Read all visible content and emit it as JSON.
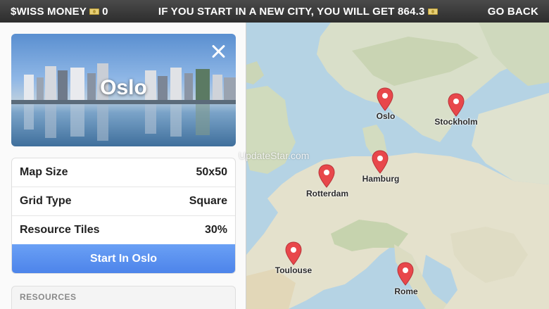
{
  "topbar": {
    "money_label": "$WISS MONEY",
    "money_icon": "cash-icon",
    "money_value": "0",
    "message": "IF YOU START IN A NEW CITY, YOU WILL GET 864.3",
    "go_back": "GO BACK"
  },
  "selected_city": {
    "name": "Oslo",
    "details": [
      {
        "label": "Map Size",
        "value": "50x50"
      },
      {
        "label": "Grid Type",
        "value": "Square"
      },
      {
        "label": "Resource Tiles",
        "value": "30%"
      }
    ],
    "start_button": "Start In Oslo",
    "resources_heading": "RESOURCES"
  },
  "map": {
    "cities": [
      {
        "name": "Oslo"
      },
      {
        "name": "Stockholm"
      },
      {
        "name": "Hamburg"
      },
      {
        "name": "Rotterdam"
      },
      {
        "name": "Toulouse"
      },
      {
        "name": "Rome"
      }
    ],
    "pin_color": "#e8474b"
  },
  "watermark": "UpdateStar.com"
}
